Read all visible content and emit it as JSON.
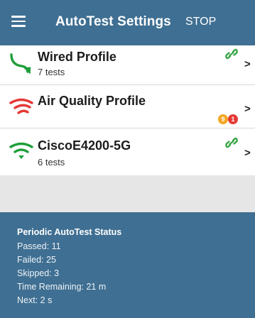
{
  "appbar": {
    "title": "AutoTest Settings",
    "stop_label": "STOP",
    "color": "#3f6f92"
  },
  "profiles": [
    {
      "name": "Wired Profile",
      "subtitle": "7 tests",
      "icon": "wired-icon",
      "linked": true,
      "badges": []
    },
    {
      "name": "Air Quality Profile",
      "subtitle": "",
      "icon": "wifi-icon",
      "linked": false,
      "badges": [
        {
          "count": "9",
          "color": "#f5a623"
        },
        {
          "count": "1",
          "color": "#e53935"
        }
      ]
    },
    {
      "name": "CiscoE4200-5G",
      "subtitle": "6 tests",
      "icon": "wifi-icon",
      "linked": true,
      "badges": []
    }
  ],
  "status": {
    "title": "Periodic AutoTest Status",
    "passed": "Passed:  11",
    "failed": "Failed:  25",
    "skipped": "Skipped:  3",
    "time_remaining": "Time Remaining:  21 m",
    "next": "Next:  2 s"
  },
  "colors": {
    "wired_icon": "#1f9e3a",
    "air_quality_icon": "#e53935",
    "wifi_icon": "#1f9e3a",
    "link_icon": "#3aa646"
  }
}
